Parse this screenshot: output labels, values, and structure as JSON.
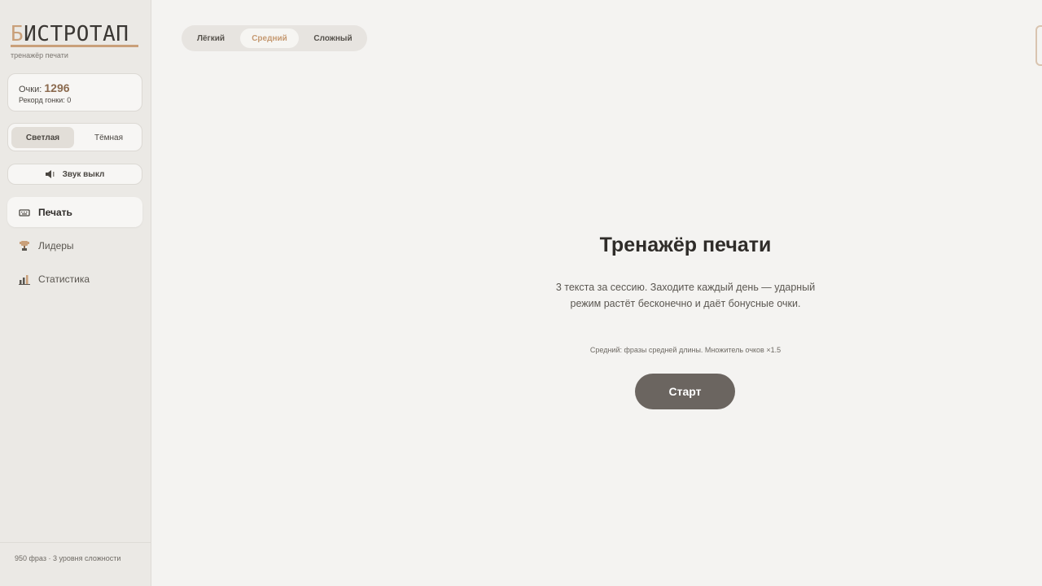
{
  "brand": {
    "logo_first_letter": "Б",
    "logo_rest": "ИСТРОТАП",
    "subtitle": "тренажёр печати",
    "accent_color": "#c9a07a"
  },
  "score": {
    "label": "Очки:",
    "value": "1296",
    "record_label": "Рекорд гонки: 0"
  },
  "theme": {
    "light": "Светлая",
    "dark": "Тёмная",
    "selected": "Светлая"
  },
  "sound": {
    "icon": "speaker-icon",
    "label": "Звук выкл"
  },
  "nav": {
    "items": [
      {
        "label": "Печать",
        "icon": "keyboard-icon",
        "active": true
      },
      {
        "label": "Лидеры",
        "icon": "trophy-icon",
        "active": false
      },
      {
        "label": "Статистика",
        "icon": "bar-chart-icon",
        "active": false
      }
    ]
  },
  "footer": {
    "text": "950 фраз · 3 уровня сложности"
  },
  "difficulty": {
    "options": [
      "Лёгкий",
      "Средний",
      "Сложный"
    ],
    "selected": "Средний"
  },
  "main": {
    "title": "Тренажёр печати",
    "description": "3 текста за сессию. Заходите каждый день — ударный режим растёт бесконечно и даёт бонусные очки.",
    "note": "Средний: фразы средней длины. Множитель очков ×1.5",
    "start_label": "Старт"
  }
}
